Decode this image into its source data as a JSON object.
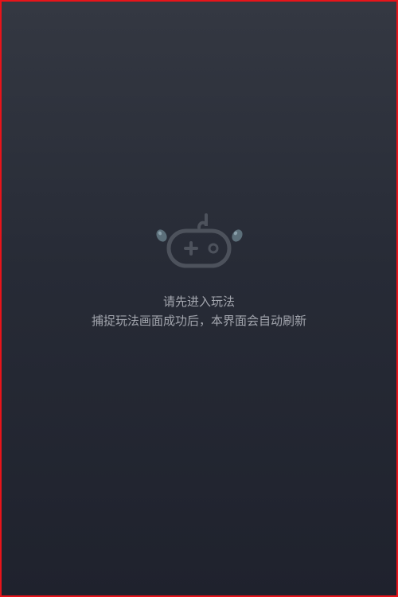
{
  "empty_state": {
    "icon": "sad-gamepad-icon",
    "line1": "请先进入玩法",
    "line2": "捕捉玩法画面成功后，本界面会自动刷新"
  },
  "colors": {
    "frame_border": "#e8141a",
    "bg_top": "#343842",
    "bg_bottom": "#1f222d",
    "text": "#a3a6ae",
    "icon_stroke": "#4d525c",
    "tear": "#5c6f7a"
  }
}
